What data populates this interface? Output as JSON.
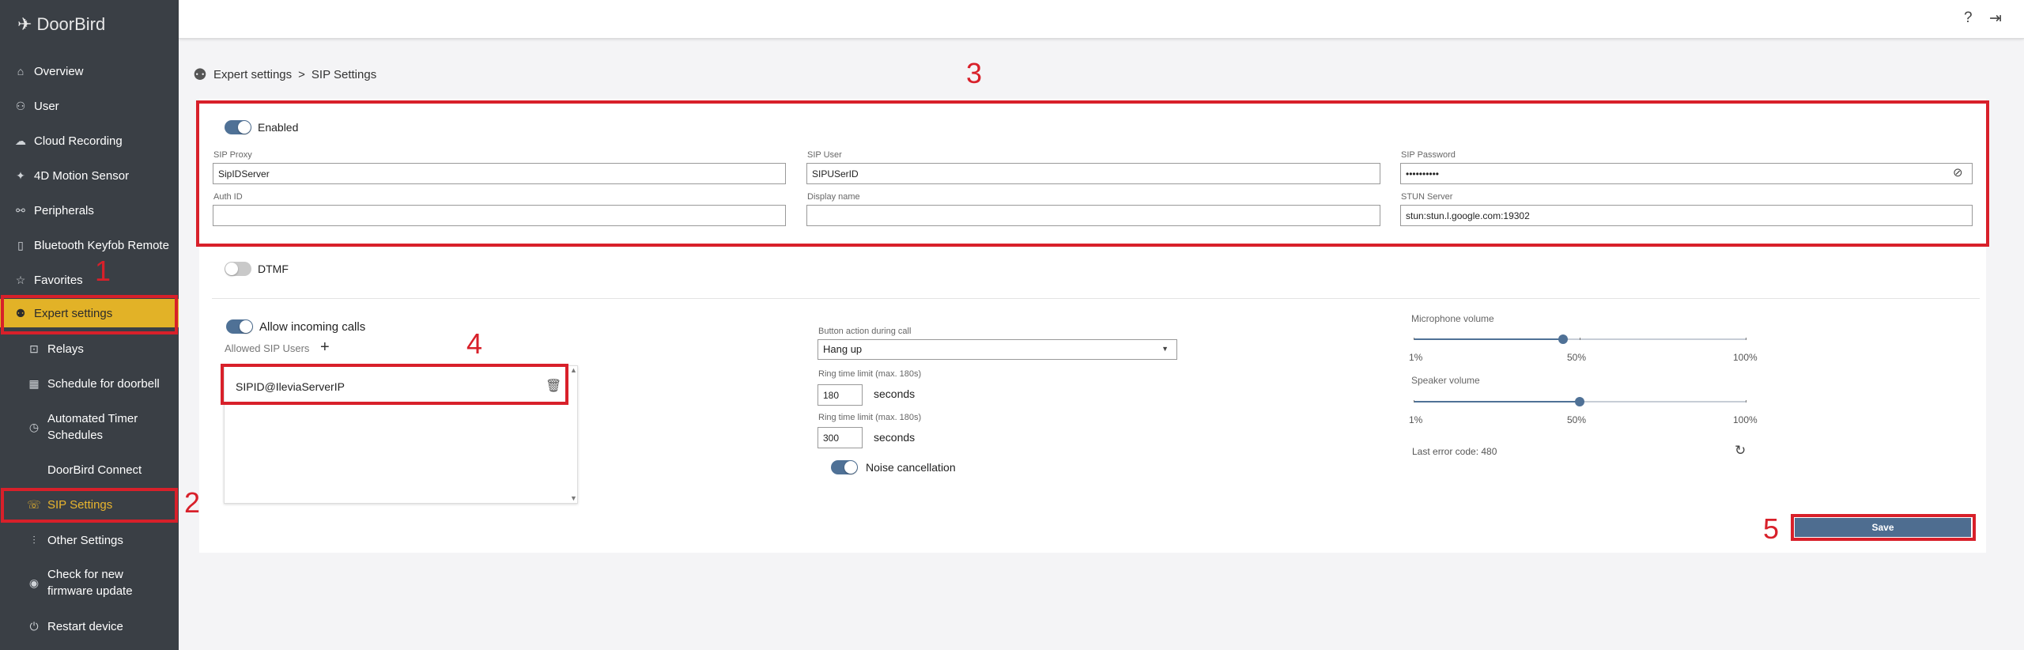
{
  "app": {
    "logo_text": "DoorBird"
  },
  "sidebar": {
    "items": [
      {
        "label": "Overview",
        "icon": "home-icon"
      },
      {
        "label": "User",
        "icon": "users-icon"
      },
      {
        "label": "Cloud Recording",
        "icon": "cloud-icon"
      },
      {
        "label": "4D Motion Sensor",
        "icon": "motion-icon"
      },
      {
        "label": "Peripherals",
        "icon": "peripherals-icon"
      },
      {
        "label": "Bluetooth Keyfob Remote",
        "icon": "keyfob-icon"
      },
      {
        "label": "Favorites",
        "icon": "star-icon"
      },
      {
        "label": "Expert settings",
        "icon": "expert-icon"
      },
      {
        "label": "Relays",
        "icon": "relay-icon"
      },
      {
        "label": "Schedule for doorbell",
        "icon": "calendar-icon"
      },
      {
        "label": "Automated Timer Schedules",
        "icon": "timer-icon"
      },
      {
        "label": "DoorBird Connect",
        "icon": "connect-icon"
      },
      {
        "label": "SIP Settings",
        "icon": "sip-icon"
      },
      {
        "label": "Other Settings",
        "icon": "sliders-icon"
      },
      {
        "label": "Check for new firmware update",
        "icon": "firmware-icon"
      },
      {
        "label": "Restart device",
        "icon": "power-icon"
      }
    ]
  },
  "topbar": {
    "help": "?",
    "logout": "⇥"
  },
  "breadcrumb": {
    "parent": "Expert settings",
    "separator": ">",
    "current": "SIP Settings"
  },
  "sip": {
    "enabled_label": "Enabled",
    "proxy": {
      "label": "SIP Proxy",
      "value": "SipIDServer"
    },
    "user": {
      "label": "SIP User",
      "value": "SIPUSerID"
    },
    "password": {
      "label": "SIP Password",
      "value": "••••••••••"
    },
    "auth_id": {
      "label": "Auth ID",
      "value": ""
    },
    "display_name": {
      "label": "Display name",
      "value": ""
    },
    "stun": {
      "label": "STUN Server",
      "value": "stun:stun.l.google.com:19302"
    }
  },
  "dtmf": {
    "label": "DTMF"
  },
  "incoming": {
    "allow_label": "Allow incoming calls",
    "allowed_users_label": "Allowed SIP Users",
    "add": "+",
    "users": [
      "SIPID@IleviaServerIP"
    ]
  },
  "call": {
    "button_action_label": "Button action during call",
    "button_action_value": "Hang up",
    "ring1_label": "Ring time limit (max. 180s)",
    "ring1_value": "180",
    "ring2_label": "Ring time limit (max. 180s)",
    "ring2_value": "300",
    "seconds": "seconds",
    "noise_label": "Noise cancellation"
  },
  "audio": {
    "mic_label": "Microphone volume",
    "mic_value": 0.45,
    "speaker_label": "Speaker volume",
    "speaker_value": 0.5,
    "min": "1%",
    "mid": "50%",
    "max": "100%",
    "last_error": "Last error code: 480"
  },
  "save_label": "Save",
  "annotations": [
    "1",
    "2",
    "3",
    "4",
    "5"
  ],
  "colors": {
    "sidebar": "#3a3f45",
    "accent": "#e2b227",
    "toggle": "#4f7196",
    "annotation": "#d8202a"
  }
}
